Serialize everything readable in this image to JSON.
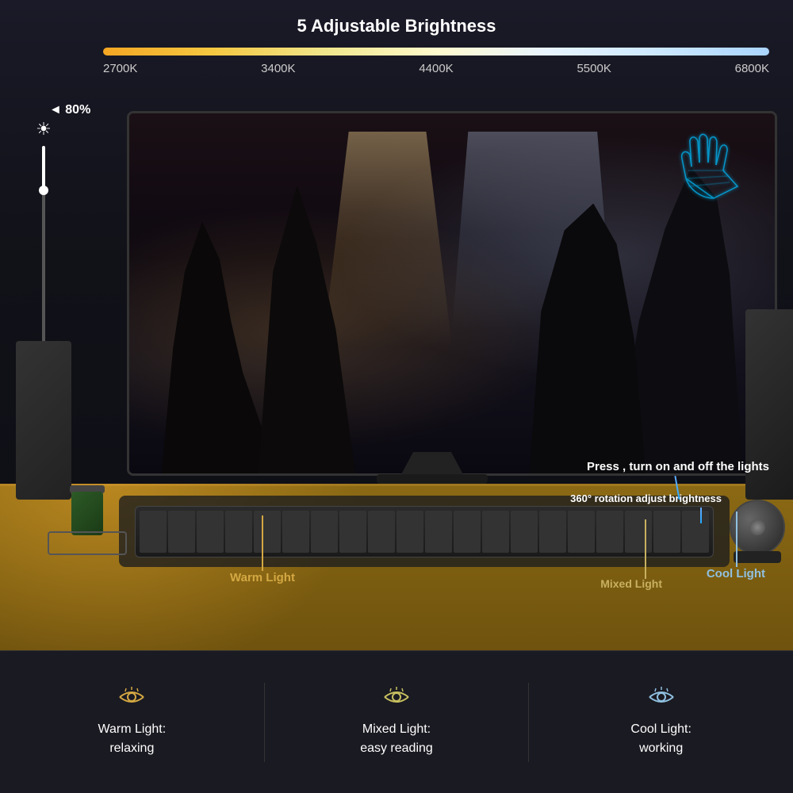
{
  "header": {
    "title": "5 Adjustable Brightness"
  },
  "temperature": {
    "values": [
      "2700K",
      "3400K",
      "4400K",
      "5500K",
      "6800K"
    ]
  },
  "brightness": {
    "label": "◄ 80%",
    "percentage": 80
  },
  "labels": {
    "warm_light": "Warm Light",
    "mixed_light": "Mixed Light",
    "cool_light": "Cool Light",
    "press_text": "Press , turn on and off the lights",
    "rotation_text": "360° rotation\nadjust brightness"
  },
  "bottom": {
    "modes": [
      {
        "icon": "warm-eye-icon",
        "label": "Warm Light:\nrelaxing",
        "color": "#d4a843"
      },
      {
        "icon": "mixed-eye-icon",
        "label": "Mixed Light:\neasy reading",
        "color": "#c8c060"
      },
      {
        "icon": "cool-eye-icon",
        "label": "Cool Light:\nworking",
        "color": "#90c0e0"
      }
    ]
  }
}
